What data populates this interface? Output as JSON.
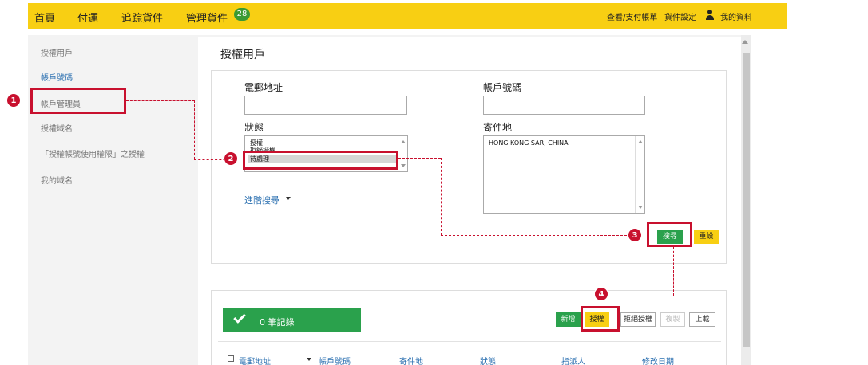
{
  "nav": {
    "items": [
      "首頁",
      "付運",
      "追踪貨件",
      "管理貨件"
    ],
    "badge": "28",
    "right": [
      "查看/支付帳單",
      "貨件設定",
      "我的資料"
    ]
  },
  "sidebar": {
    "items": [
      "授權用戶",
      "帳戶號碼",
      "帳戶管理員",
      "授權域名",
      "「授權帳號使用權限」之授權",
      "我的域名"
    ]
  },
  "main": {
    "title": "授權用戶",
    "search": {
      "email_label": "電郵地址",
      "email_value": "",
      "account_label": "帳戶號碼",
      "account_value": "",
      "status_label": "狀態",
      "status_options": [
        "授權",
        "拒絕授權",
        "待處理"
      ],
      "origin_label": "寄件地",
      "origin_value": "HONG KONG SAR, CHINA",
      "advanced_label": "進階搜尋",
      "search_button": "搜尋",
      "reset_button": "重設"
    },
    "results": {
      "records_label": "0 筆記錄",
      "actions": [
        "新增",
        "授權",
        "拒絕授權",
        "複製",
        "上載"
      ],
      "columns": [
        "電郵地址",
        "帳戶號碼",
        "寄件地",
        "狀態",
        "指派人",
        "修改日期"
      ]
    }
  },
  "annotations": [
    "1",
    "2",
    "3",
    "4"
  ],
  "colors": {
    "accent": "#f8cf13",
    "primary": "#2aa14c",
    "highlight": "#c8102e",
    "link": "#2a6fb0"
  }
}
